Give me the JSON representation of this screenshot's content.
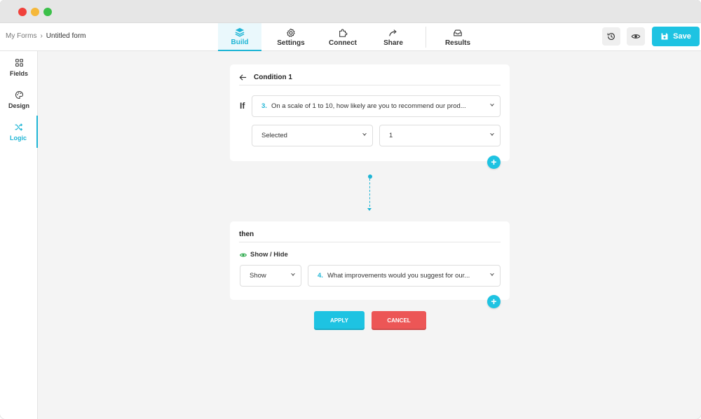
{
  "breadcrumb": {
    "root": "My Forms",
    "separator": "›",
    "current": "Untitled form"
  },
  "nav": {
    "tabs": [
      {
        "label": "Build",
        "icon": "layers-icon",
        "active": true
      },
      {
        "label": "Settings",
        "icon": "gear-icon",
        "active": false
      },
      {
        "label": "Connect",
        "icon": "puzzle-icon",
        "active": false
      },
      {
        "label": "Share",
        "icon": "share-arrow-icon",
        "active": false
      },
      {
        "label": "Results",
        "icon": "inbox-icon",
        "active": false
      }
    ]
  },
  "toolbar": {
    "history_icon": "history-icon",
    "preview_icon": "eye-icon",
    "save_label": "Save"
  },
  "sidebar": {
    "items": [
      {
        "label": "Fields",
        "icon": "grid-icon",
        "active": false
      },
      {
        "label": "Design",
        "icon": "palette-icon",
        "active": false
      },
      {
        "label": "Logic",
        "icon": "shuffle-icon",
        "active": true
      }
    ]
  },
  "condition": {
    "title": "Condition 1",
    "if_label": "If",
    "question": {
      "number": "3.",
      "text": "On a scale of 1 to 10, how likely are you to recommend our prod..."
    },
    "operator": "Selected",
    "value": "1",
    "add_label": "+"
  },
  "action": {
    "title": "then",
    "type_label": "Show / Hide",
    "mode": "Show",
    "target": {
      "number": "4.",
      "text": "What improvements would you suggest for our..."
    },
    "add_label": "+"
  },
  "buttons": {
    "apply": "APPLY",
    "cancel": "CANCEL"
  },
  "colors": {
    "accent": "#1ec3e2",
    "danger": "#ec5656",
    "success": "#2aa84a"
  }
}
